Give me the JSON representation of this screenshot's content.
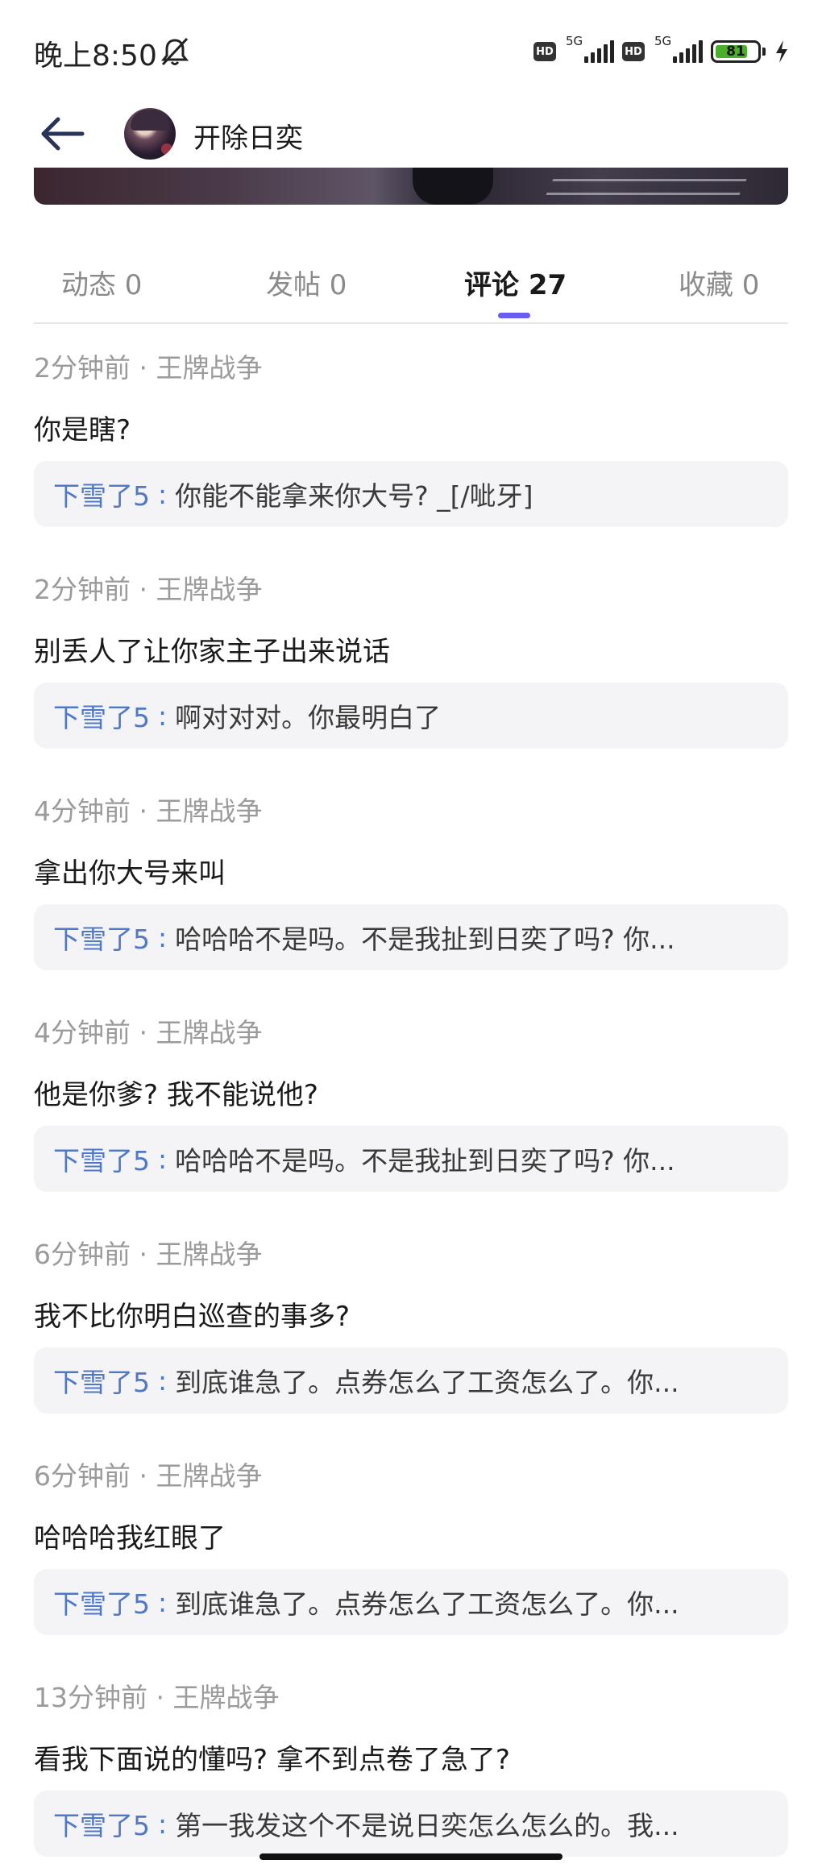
{
  "status_bar": {
    "time": "晚上8:50",
    "network_1": "5G",
    "network_2": "5G",
    "hd_1": "HD",
    "hd_2": "HD",
    "battery": "81",
    "icons": [
      "mute-icon",
      "signal-icon",
      "battery-icon",
      "charging-icon"
    ]
  },
  "header": {
    "title": "开除日奕",
    "icons": [
      "back-arrow-icon",
      "avatar"
    ]
  },
  "tabs": [
    {
      "label": "动态 0"
    },
    {
      "label": "发帖 0"
    },
    {
      "label": "评论 27",
      "active": true
    },
    {
      "label": "收藏 0"
    }
  ],
  "colors": {
    "accent": "#6a5cf0",
    "reply_user": "#4f78c8",
    "meta": "#9b9b9b",
    "reply_bg": "#f4f4f6"
  },
  "comments": [
    {
      "meta": "2分钟前 · 王牌战争",
      "text": "你是瞎?",
      "reply_user": "下雪了5",
      "reply_sep": ":",
      "reply_text": "你能不能拿来你大号? _[/呲牙]"
    },
    {
      "meta": "2分钟前 · 王牌战争",
      "text": "别丢人了让你家主子出来说话",
      "reply_user": "下雪了5",
      "reply_sep": ":",
      "reply_text": "啊对对对。你最明白了"
    },
    {
      "meta": "4分钟前 · 王牌战争",
      "text": "拿出你大号来叫",
      "reply_user": "下雪了5",
      "reply_sep": ":",
      "reply_text": "哈哈哈不是吗。不是我扯到日奕了吗? 你..."
    },
    {
      "meta": "4分钟前 · 王牌战争",
      "text": "他是你爹? 我不能说他?",
      "reply_user": "下雪了5",
      "reply_sep": ":",
      "reply_text": "哈哈哈不是吗。不是我扯到日奕了吗? 你..."
    },
    {
      "meta": "6分钟前 · 王牌战争",
      "text": "我不比你明白巡查的事多?",
      "reply_user": "下雪了5",
      "reply_sep": ":",
      "reply_text": "到底谁急了。点券怎么了工资怎么了。你..."
    },
    {
      "meta": "6分钟前 · 王牌战争",
      "text": "哈哈哈我红眼了",
      "reply_user": "下雪了5",
      "reply_sep": ":",
      "reply_text": "到底谁急了。点券怎么了工资怎么了。你..."
    },
    {
      "meta": "13分钟前 · 王牌战争",
      "text": "看我下面说的懂吗? 拿不到点卷了急了?",
      "reply_user": "下雪了5",
      "reply_sep": ":",
      "reply_text": "第一我发这个不是说日奕怎么怎么的。我..."
    }
  ]
}
